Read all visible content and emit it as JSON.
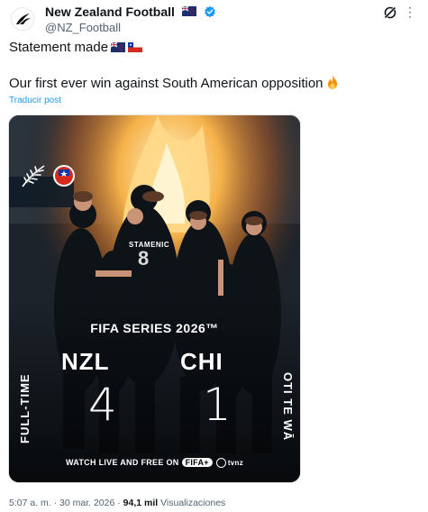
{
  "account": {
    "display_name": "New Zealand Football",
    "handle": "@NZ_Football"
  },
  "post": {
    "line1": "Statement made",
    "line2": "Our first ever win against South American opposition",
    "translate_label": "Traducir post"
  },
  "media": {
    "jersey_name": "STAMENIC",
    "jersey_number": "8",
    "side_left": "FULL-TIME",
    "side_right": "OTI TE WĀ",
    "competition": "FIFA SERIES 2026™",
    "home_team": "NZL",
    "away_team": "CHI",
    "home_score": "4",
    "away_score": "1",
    "watch_text": "WATCH LIVE AND FREE ON",
    "watch_platform": "FIFA+",
    "broadcaster": "tvnz"
  },
  "meta": {
    "time_date": "5:07 a. m. · 30 mar. 2026 · ",
    "views_count": "94,1 mil",
    "views_label": " Visualizaciones"
  },
  "icons": {
    "verified": "verified-badge-icon",
    "grok": "grok-icon",
    "more": "more-options-icon"
  },
  "colors": {
    "link": "#1d9bf0",
    "secondary_text": "#536471",
    "verified": "#1d9bf0"
  }
}
